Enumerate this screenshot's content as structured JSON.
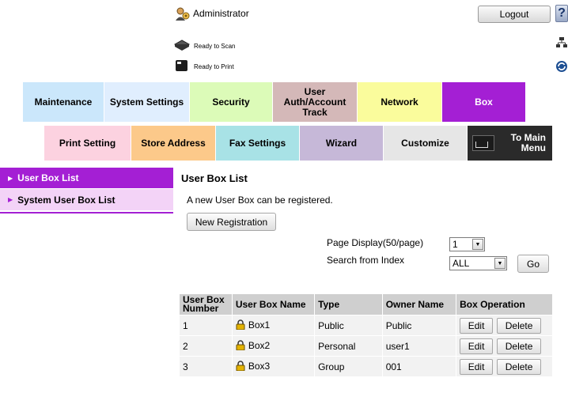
{
  "header": {
    "user_label": "Administrator",
    "logout_label": "Logout",
    "help_label": "?",
    "scan_status": "Ready to Scan",
    "print_status": "Ready to Print"
  },
  "nav_main": [
    {
      "label": "Maintenance",
      "color": "#cbe7fb"
    },
    {
      "label": "System Settings",
      "color": "#e0eefe"
    },
    {
      "label": "Security",
      "color": "#dcfbb8"
    },
    {
      "label": "User\nAuth/Account\nTrack",
      "color": "#d4b8b8"
    },
    {
      "label": "Network",
      "color": "#fafc9c"
    },
    {
      "label": "Box",
      "color": "#a41fd4",
      "active": true
    }
  ],
  "nav_sub": [
    {
      "label": "Print Setting",
      "color": "#fcd2e0"
    },
    {
      "label": "Store Address",
      "color": "#fcc98a"
    },
    {
      "label": "Fax Settings",
      "color": "#a8e2e6"
    },
    {
      "label": "Wizard",
      "color": "#c6b8d8"
    },
    {
      "label": "Customize",
      "color": "#e6e6e6"
    },
    {
      "label": "To Main\nMenu",
      "color": "#2a2a2a"
    }
  ],
  "side_menu": {
    "active_label": "User Box List",
    "item2_label": "System User Box List"
  },
  "content": {
    "title": "User Box List",
    "description": "A new User Box can be registered.",
    "new_registration_label": "New Registration",
    "page_display_label": "Page Display(50/page)",
    "page_value": "1",
    "search_index_label": "Search from Index",
    "index_value": "ALL",
    "go_label": "Go"
  },
  "table": {
    "headers": [
      "User Box\nNumber",
      "User Box Name",
      "Type",
      "Owner Name",
      "Box Operation"
    ],
    "rows": [
      {
        "number": "1",
        "name": "Box1",
        "type": "Public",
        "owner": "Public",
        "edit": "Edit",
        "delete": "Delete"
      },
      {
        "number": "2",
        "name": "Box2",
        "type": "Personal",
        "owner": "user1",
        "edit": "Edit",
        "delete": "Delete"
      },
      {
        "number": "3",
        "name": "Box3",
        "type": "Group",
        "owner": "001",
        "edit": "Edit",
        "delete": "Delete"
      }
    ]
  },
  "colors": {
    "accent": "#a41fd4",
    "side_inactive": "#f3d3f7",
    "table_header": "#cfcfcf",
    "table_cell": "#f2f2f2"
  }
}
